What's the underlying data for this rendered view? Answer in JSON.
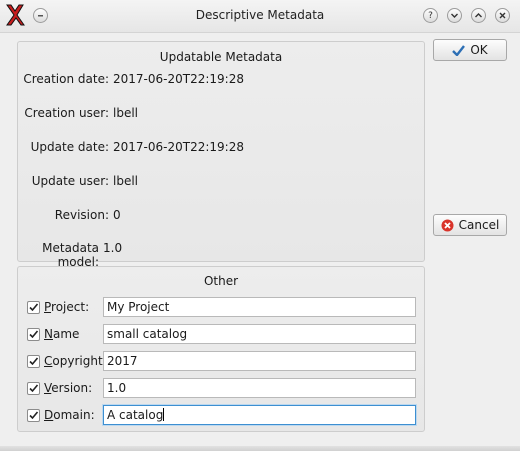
{
  "window": {
    "title": "Descriptive Metadata",
    "titlebar_buttons": [
      "help-icon",
      "chevron-down-icon",
      "chevron-up-icon",
      "close-icon"
    ]
  },
  "updatable": {
    "title": "Updatable Metadata",
    "rows": [
      {
        "label": "Creation date:",
        "value": "2017-06-20T22:19:28"
      },
      {
        "label": "Creation user:",
        "value": "lbell"
      },
      {
        "label": "Update date:",
        "value": "2017-06-20T22:19:28"
      },
      {
        "label": "Update user:",
        "value": "lbell"
      },
      {
        "label": "Revision:",
        "value": "0"
      },
      {
        "label": "Metadata model:",
        "value": "1.0"
      }
    ]
  },
  "buttons": {
    "ok_label": "OK",
    "cancel_label": "Cancel"
  },
  "other": {
    "title": "Other",
    "fields": [
      {
        "accel": "P",
        "rest": "roject:",
        "value": "My Project",
        "checked": true
      },
      {
        "accel": "N",
        "rest": "ame",
        "value": "small catalog",
        "checked": true
      },
      {
        "accel": "C",
        "rest": "opyright:",
        "value": "2017",
        "checked": true
      },
      {
        "accel": "V",
        "rest": "ersion:",
        "value": "1.0",
        "checked": true
      },
      {
        "accel": "D",
        "rest": "omain:",
        "value": "A catalog",
        "checked": true
      }
    ]
  },
  "colors": {
    "ok_check": "#2d6fb5",
    "cancel_red": "#d9342b",
    "focus_border": "#3d8fd1"
  }
}
